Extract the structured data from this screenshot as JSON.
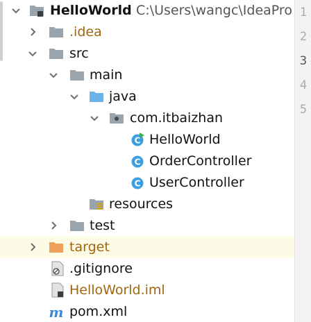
{
  "project_tree": {
    "root": {
      "name": "HelloWorld",
      "path": "C:\\Users\\wangc\\IdeaPro"
    },
    "nodes": [
      {
        "label": ".idea"
      },
      {
        "label": "src"
      },
      {
        "label": "main"
      },
      {
        "label": "java"
      },
      {
        "label": "com.itbaizhan"
      },
      {
        "label": "HelloWorld"
      },
      {
        "label": "OrderController"
      },
      {
        "label": "UserController"
      },
      {
        "label": "resources"
      },
      {
        "label": "test"
      },
      {
        "label": "target"
      },
      {
        "label": ".gitignore"
      },
      {
        "label": "HelloWorld.iml"
      },
      {
        "label": "pom.xml"
      }
    ]
  },
  "editor_gutter": {
    "line_numbers": [
      "1",
      "2",
      "3",
      "4",
      "5"
    ],
    "current_line": "3"
  },
  "colors": {
    "highlight_row": "#fdfbe6",
    "excluded_text": "#a0670e",
    "folder_gray": "#9aa4ad",
    "source_folder": "#6cb4e8",
    "class_icon": "#3d9fe0",
    "target_folder": "#f0a05a"
  }
}
